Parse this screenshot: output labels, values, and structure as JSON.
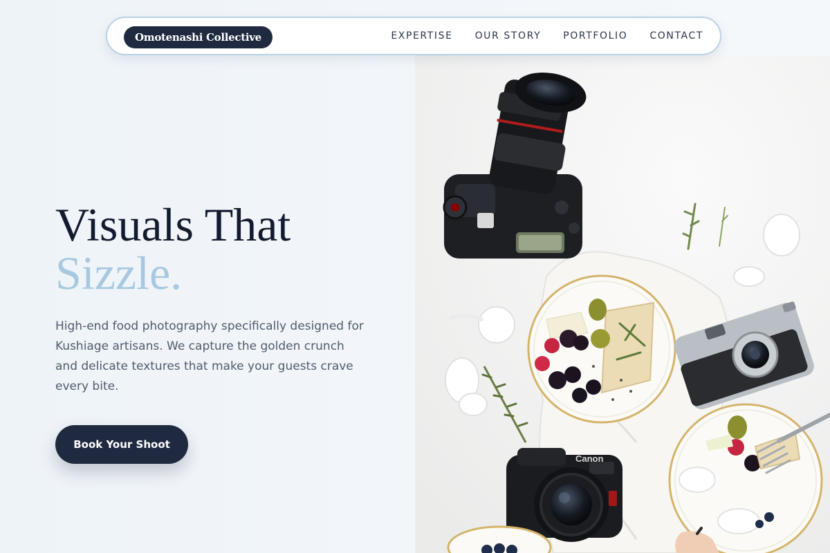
{
  "nav": {
    "brand": "Omotenashi Collective",
    "links": [
      {
        "label": "EXPERTISE"
      },
      {
        "label": "OUR STORY"
      },
      {
        "label": "PORTFOLIO"
      },
      {
        "label": "CONTACT"
      }
    ]
  },
  "hero": {
    "headline_line1": "Visuals That",
    "headline_line2": "Sizzle.",
    "description": "High-end food photography specifically designed for Kushiage artisans. We capture the golden crunch and delicate textures that make your guests crave every bite.",
    "cta_label": "Book Your Shoot"
  },
  "photo": {
    "icons": [
      "camera-icon",
      "plate-icon",
      "fork-icon"
    ],
    "camera_brand_text": "Canon"
  },
  "colors": {
    "primary_dark": "#1f2a40",
    "headline_text": "#131b2e",
    "accent_light_blue": "#a7c9e0",
    "nav_border": "#b9d2e4",
    "body_text": "#4f5b6d",
    "background": "#eef3f8"
  }
}
